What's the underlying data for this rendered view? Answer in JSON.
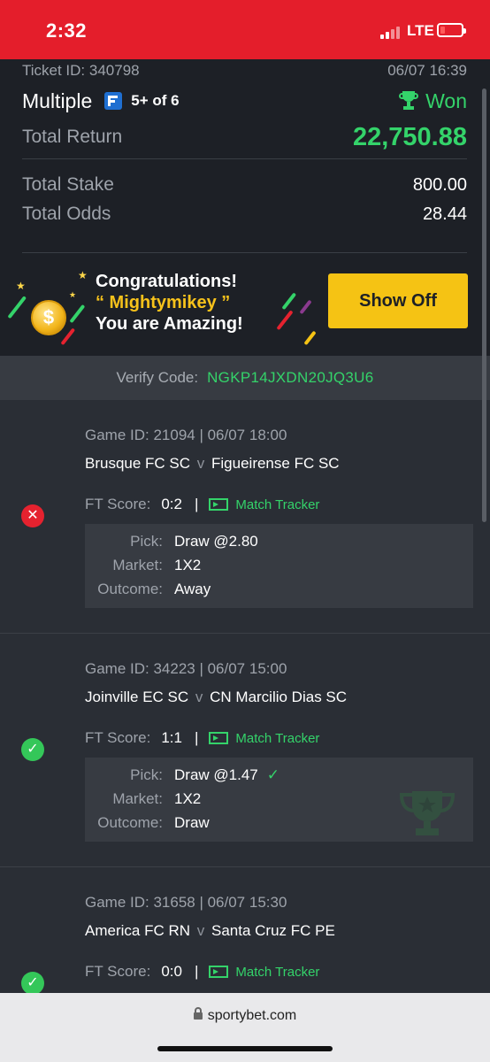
{
  "status_bar": {
    "time": "2:32",
    "network": "LTE"
  },
  "ticket": {
    "id_label": "Ticket ID: 340798",
    "datetime": "06/07 16:39",
    "bet_type": "Multiple",
    "count": "5+ of 6",
    "status": "Won",
    "total_return_label": "Total Return",
    "total_return": "22,750.88",
    "total_stake_label": "Total Stake",
    "total_stake": "800.00",
    "total_odds_label": "Total Odds",
    "total_odds": "28.44"
  },
  "banner": {
    "line1": "Congratulations!",
    "line2": "“ Mightymikey ”",
    "line3": "You are Amazing!",
    "button": "Show Off",
    "coin_symbol": "$"
  },
  "verify": {
    "label": "Verify Code:",
    "code": "NGKP14JXDN20JQ3U6"
  },
  "games": [
    {
      "game_id": "Game ID: 21094 | 06/07 18:00",
      "home": "Brusque FC SC",
      "vs": "v",
      "away": "Figueirense FC SC",
      "score_label": "FT Score:",
      "score": "0:2",
      "sep": "|",
      "tracker": "Match Tracker",
      "pick_label": "Pick:",
      "pick": "Draw @2.80",
      "market_label": "Market:",
      "market": "1X2",
      "outcome_label": "Outcome:",
      "outcome": "Away",
      "result": "lost",
      "status_glyph": "✕"
    },
    {
      "game_id": "Game ID: 34223 | 06/07 15:00",
      "home": "Joinville EC SC",
      "vs": "v",
      "away": "CN Marcilio Dias SC",
      "score_label": "FT Score:",
      "score": "1:1",
      "sep": "|",
      "tracker": "Match Tracker",
      "pick_label": "Pick:",
      "pick": "Draw @1.47",
      "pick_check": "✓",
      "market_label": "Market:",
      "market": "1X2",
      "outcome_label": "Outcome:",
      "outcome": "Draw",
      "result": "won",
      "status_glyph": "✓"
    },
    {
      "game_id": "Game ID: 31658 | 06/07 15:30",
      "home": "America FC RN",
      "vs": "v",
      "away": "Santa Cruz FC PE",
      "score_label": "FT Score:",
      "score": "0:0",
      "sep": "|",
      "tracker": "Match Tracker",
      "result": "won",
      "status_glyph": "✓"
    }
  ],
  "browser": {
    "url": "sportybet.com"
  },
  "colors": {
    "accent_green": "#34d36a",
    "brand_red": "#e41e2b",
    "button_yellow": "#f5c314",
    "lost_red": "#e5222f"
  }
}
